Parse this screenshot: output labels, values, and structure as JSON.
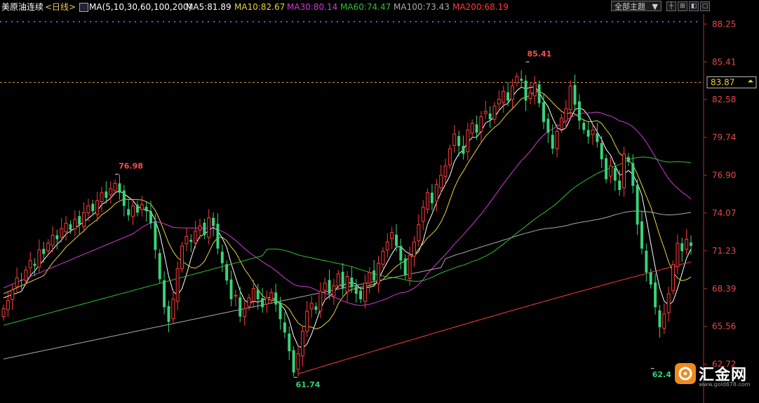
{
  "header": {
    "instrument": "美原油连续",
    "period": "<日线>",
    "ma_indicator": "MA(5,10,30,60,100,200)",
    "ma_values": [
      {
        "label": "MA5:81.89",
        "color": "#ffffff"
      },
      {
        "label": "MA10:82.67",
        "color": "#e6d33c"
      },
      {
        "label": "MA30:80.14",
        "color": "#d23ad2"
      },
      {
        "label": "MA60:74.47",
        "color": "#2fc02f"
      },
      {
        "label": "MA100:73.43",
        "color": "#a9a9a9"
      },
      {
        "label": "MA200:68.19",
        "color": "#ff3b3b"
      }
    ],
    "theme_select": "全部主题",
    "theme_arrow": "▼",
    "tool_buttons": [
      "┼",
      "⊞",
      "◧",
      "▢"
    ]
  },
  "price_axis": {
    "ticks": [
      "88.25",
      "85.41",
      "82.58",
      "79.74",
      "76.90",
      "74.07",
      "71.23",
      "68.39",
      "65.56",
      "62.72"
    ],
    "current_price": "83.87"
  },
  "annotations": [
    {
      "label": "76.98",
      "kind": "high",
      "color": "#ff4d4d"
    },
    {
      "label": "61.74",
      "kind": "low",
      "color": "#33d17a"
    },
    {
      "label": "85.41",
      "kind": "high",
      "color": "#ff4d4d"
    },
    {
      "label": "62.4",
      "kind": "low",
      "color": "#33d17a"
    }
  ],
  "chart_data": {
    "type": "candlestick",
    "y_range": [
      60.6,
      89.0
    ],
    "current_price": 83.87,
    "close_series": [
      66.9,
      67.5,
      68.3,
      69.2,
      69.0,
      69.8,
      70.5,
      70.1,
      71.3,
      71.0,
      71.8,
      72.4,
      72.1,
      72.9,
      73.3,
      72.8,
      73.6,
      73.2,
      74.1,
      74.6,
      74.2,
      75.0,
      75.6,
      75.2,
      75.9,
      76.3,
      75.6,
      74.6,
      73.9,
      74.6,
      74.1,
      74.7,
      74.2,
      73.3,
      71.3,
      69.1,
      67.0,
      65.9,
      67.6,
      69.9,
      71.6,
      72.3,
      71.9,
      72.7,
      73.1,
      72.4,
      73.7,
      73.1,
      71.4,
      70.3,
      69.0,
      67.6,
      67.9,
      66.3,
      66.9,
      67.7,
      68.4,
      67.6,
      67.0,
      67.7,
      68.1,
      67.2,
      66.1,
      65.1,
      63.7,
      62.1,
      63.5,
      65.2,
      66.7,
      67.3,
      66.8,
      68.2,
      68.8,
      68.0,
      68.6,
      69.5,
      68.4,
      69.3,
      68.5,
      68.0,
      67.6,
      68.8,
      69.6,
      69.0,
      70.3,
      71.2,
      71.9,
      72.6,
      71.6,
      70.5,
      69.4,
      70.9,
      71.9,
      73.2,
      74.5,
      75.6,
      74.8,
      76.2,
      76.9,
      77.6,
      78.9,
      80.0,
      79.1,
      78.5,
      80.3,
      80.8,
      80.1,
      81.3,
      81.7,
      81.1,
      82.1,
      82.6,
      83.2,
      82.5,
      83.6,
      84.3,
      84.0,
      82.5,
      83.1,
      83.8,
      82.3,
      80.9,
      80.1,
      78.9,
      80.2,
      81.2,
      81.9,
      83.6,
      82.2,
      81.0,
      80.3,
      79.8,
      80.3,
      79.4,
      78.1,
      76.6,
      77.6,
      76.5,
      75.8,
      78.5,
      77.9,
      76.1,
      73.2,
      71.4,
      69.6,
      68.7,
      67.0,
      65.5,
      66.5,
      68.0,
      70.2,
      71.8,
      71.2,
      72.1,
      71.6
    ]
  }
}
